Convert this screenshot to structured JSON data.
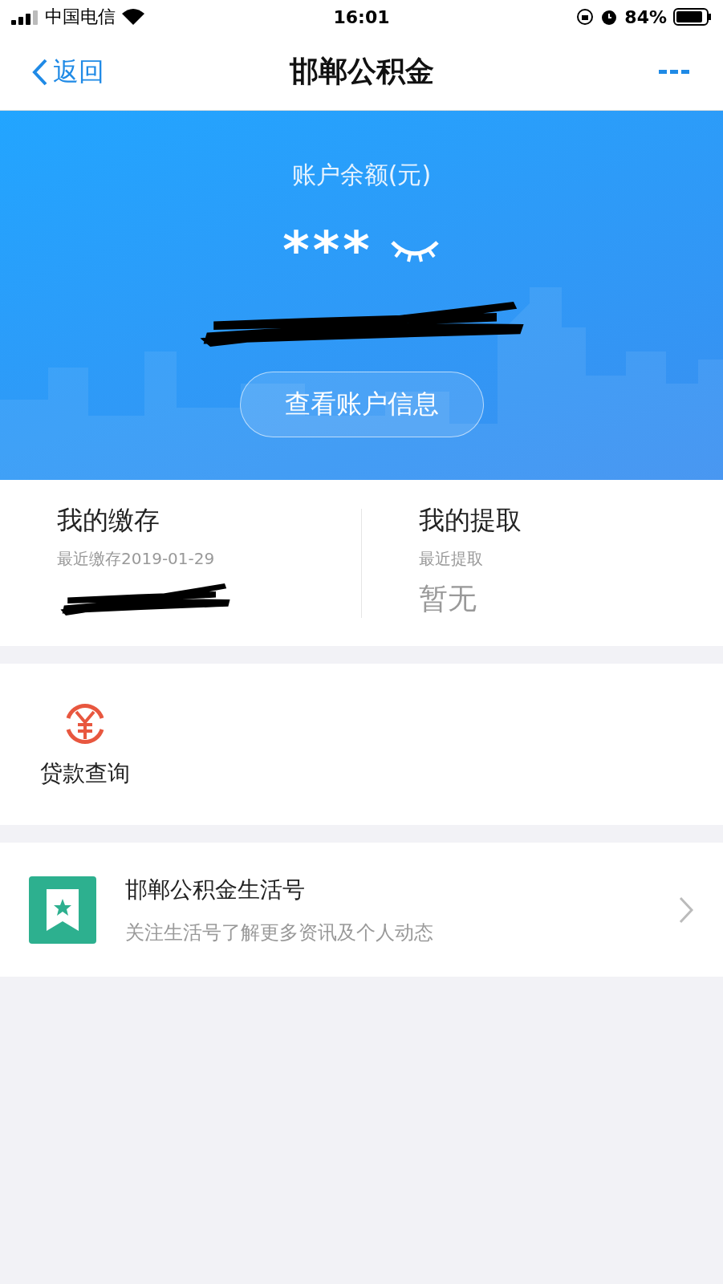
{
  "status_bar": {
    "carrier": "中国电信",
    "time": "16:01",
    "battery": "84%"
  },
  "nav": {
    "back": "返回",
    "title": "邯郸公积金"
  },
  "balance": {
    "label": "账户余额(元)",
    "value": "***",
    "redacted": true,
    "button": "查看账户信息"
  },
  "stats": [
    {
      "title": "我的缴存",
      "caption": "最近缴存2019-01-29",
      "redacted": true
    },
    {
      "title": "我的提取",
      "caption": "最近提取",
      "value": "暂无",
      "redacted": false
    }
  ],
  "services": [
    {
      "label": "贷款查询"
    }
  ],
  "life": {
    "title": "邯郸公积金生活号",
    "subtitle": "关注生活号了解更多资讯及个人动态"
  }
}
